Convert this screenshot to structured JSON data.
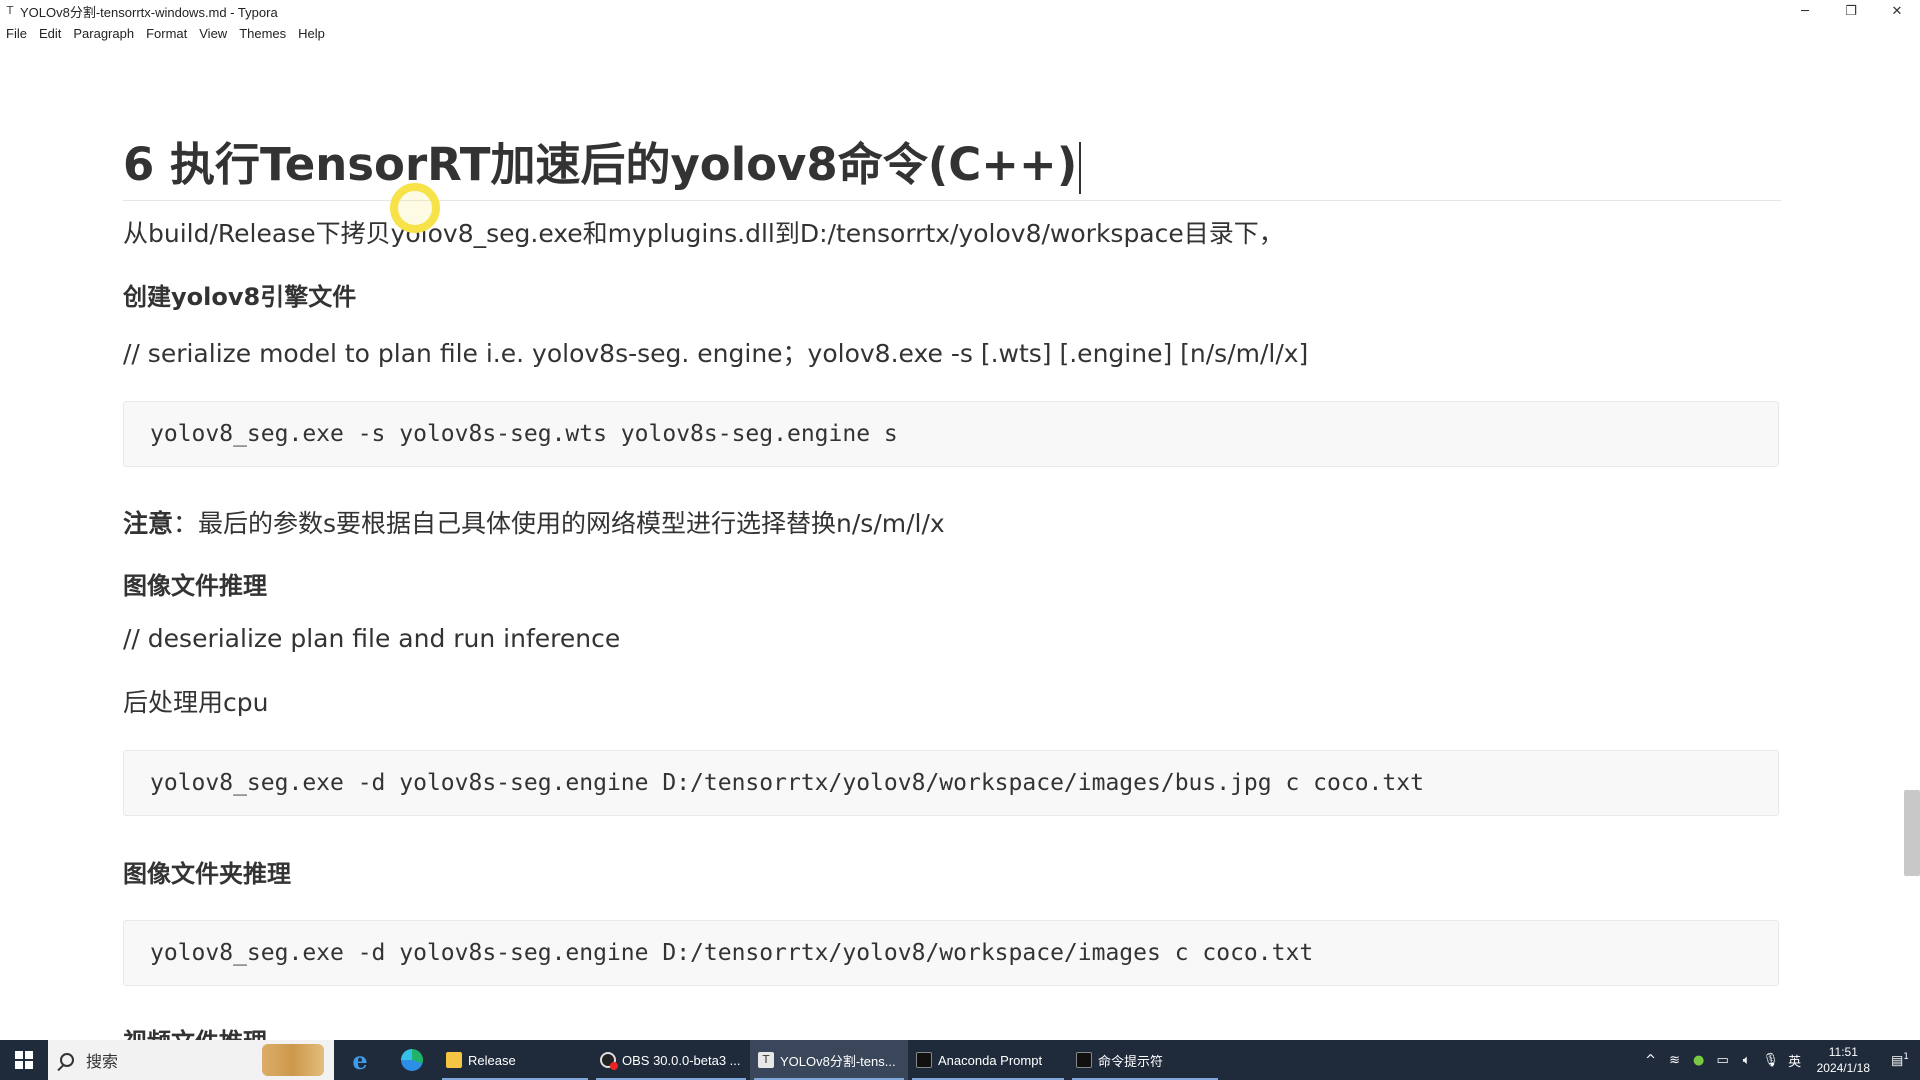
{
  "window": {
    "icon": "T",
    "title": "YOLOv8分割-tensorrtx-windows.md - Typora",
    "controls": {
      "minimize": "─",
      "restore": "❐",
      "close": "✕"
    }
  },
  "menu": [
    "File",
    "Edit",
    "Paragraph",
    "Format",
    "View",
    "Themes",
    "Help"
  ],
  "document": {
    "heading": "6  执行TensorRT加速后的yolov8命令(C++)",
    "copy_instruction": "从build/Release下拷贝yolov8_seg.exe和myplugins.dll到D:/tensorrtx/yolov8/workspace目录下，",
    "create_engine_heading": "创建yolov8引擎文件",
    "serialize_comment": "// serialize model to plan file i.e. yolov8s-seg. engine；yolov8.exe  -s [.wts] [.engine] [n/s/m/l/x]",
    "code_serialize": "yolov8_seg.exe -s yolov8s-seg.wts yolov8s-seg.engine s",
    "note_label": "注意",
    "note_text": "：最后的参数s要根据自己具体使用的网络模型进行选择替换n/s/m/l/x",
    "image_infer_heading": "图像文件推理",
    "deserialize_comment": "// deserialize plan file and run inference",
    "postprocess": "后处理用cpu",
    "code_image": "yolov8_seg.exe -d yolov8s-seg.engine D:/tensorrtx/yolov8/workspace/images/bus.jpg c coco.txt",
    "folder_infer_heading": "图像文件夹推理",
    "code_folder": "yolov8_seg.exe -d yolov8s-seg.engine D:/tensorrtx/yolov8/workspace/images c coco.txt",
    "video_infer_heading": "视频文件推理"
  },
  "taskbar": {
    "search_placeholder": "搜索",
    "ie_glyph": "e",
    "apps": [
      {
        "label": "Release",
        "icon": "folder-icon"
      },
      {
        "label": "OBS 30.0.0-beta3 ...",
        "icon": "obs-icon"
      },
      {
        "label": "YOLOv8分割-tens...",
        "icon": "typora-icon"
      },
      {
        "label": "Anaconda Prompt",
        "icon": "terminal-icon"
      },
      {
        "label": "命令提示符",
        "icon": "cmd-icon"
      }
    ],
    "tray": {
      "chevron": "^",
      "ime": "英",
      "time": "11:51",
      "date": "2024/1/18",
      "notification_badge": "1"
    }
  }
}
